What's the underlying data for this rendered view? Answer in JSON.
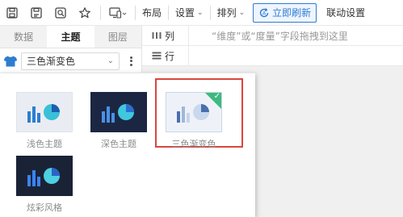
{
  "toolbar": {
    "icons": [
      "save-icon",
      "save-as-icon",
      "preview-icon",
      "star-icon",
      "device-icon"
    ],
    "menus": [
      {
        "label": "布局",
        "key": "layout"
      },
      {
        "label": "设置",
        "key": "settings"
      },
      {
        "label": "排列",
        "key": "arrange"
      }
    ],
    "refresh_label": "立即刷新",
    "link_label": "联动设置"
  },
  "left_panel": {
    "tabs": [
      {
        "label": "数据",
        "active": false
      },
      {
        "label": "主题",
        "active": true
      },
      {
        "label": "图层",
        "active": false
      }
    ],
    "theme_select": {
      "value": "三色渐变色"
    }
  },
  "shelves": {
    "columns_label": "列",
    "rows_label": "行",
    "drop_hint": "“维度”或“度量”字段拖拽到这里"
  },
  "theme_popup": {
    "themes": [
      {
        "name": "浅色主题",
        "style": "light",
        "selected": false
      },
      {
        "name": "深色主题",
        "style": "dark",
        "selected": false
      },
      {
        "name": "三色渐变色",
        "style": "gradient",
        "selected": true
      },
      {
        "name": "炫彩风格",
        "style": "colorful",
        "selected": false
      }
    ]
  },
  "colors": {
    "accent_blue": "#2f7cd3",
    "selection_red": "#d9463f",
    "check_green": "#3dbb7e",
    "dark_thumb_bg": "#1b2742"
  }
}
